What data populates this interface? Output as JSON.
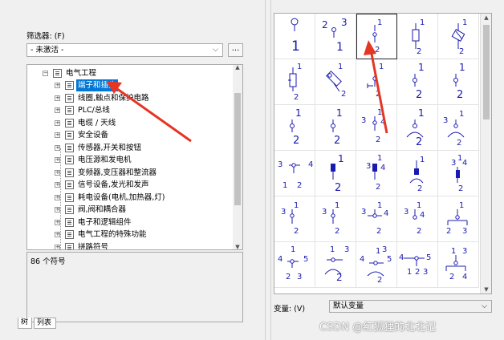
{
  "filter": {
    "label": "筛选器: (F)",
    "selected": "- 未激活 -",
    "more_button": "..."
  },
  "tree": {
    "root": "电气工程",
    "items": [
      {
        "label": "端子和插头"
      },
      {
        "label": "线圈,触点和保护电路"
      },
      {
        "label": "PLC/总线"
      },
      {
        "label": "电缆 / 天线"
      },
      {
        "label": "安全设备"
      },
      {
        "label": "传感器,开关和按钮"
      },
      {
        "label": "电压源和发电机"
      },
      {
        "label": "变频器,变压器和整流器"
      },
      {
        "label": "信号设备,发光和发声"
      },
      {
        "label": "耗电设备(电机,加热器,灯)"
      },
      {
        "label": "阀,阀和耦合器"
      },
      {
        "label": "电子和逻辑组件"
      },
      {
        "label": "电气工程的特殊功能"
      },
      {
        "label": "拼路符号"
      }
    ],
    "selected_index": 0,
    "expand_collapsed": "+",
    "expand_open": "−"
  },
  "symbol_count": "86 个符号",
  "tabs": [
    {
      "label": "树"
    },
    {
      "label": "列表"
    }
  ],
  "variant": {
    "label": "变量: (V)",
    "selected": "默认变量"
  },
  "symbols": [
    {
      "labels": [
        "1"
      ],
      "kind": "terminal-large",
      "selected": false
    },
    {
      "labels": [
        "2",
        "3",
        "1"
      ],
      "kind": "terminal-3",
      "selected": false
    },
    {
      "labels": [
        "1",
        "2"
      ],
      "kind": "terminal-small",
      "selected": true
    },
    {
      "labels": [
        "1",
        "2"
      ],
      "kind": "fuse-terminal",
      "selected": false
    },
    {
      "labels": [
        "1",
        "2"
      ],
      "kind": "fuse-terminal-diag",
      "selected": false
    },
    {
      "labels": [
        "1",
        "2"
      ],
      "kind": "fuse-side",
      "selected": false
    },
    {
      "labels": [
        "1",
        "2"
      ],
      "kind": "fuse-rotated",
      "selected": false
    },
    {
      "labels": [
        "1",
        "2"
      ],
      "kind": "terminal-tap",
      "selected": false
    },
    {
      "labels": [
        "1",
        "2"
      ],
      "kind": "terminal-plain",
      "selected": false
    },
    {
      "labels": [
        "1",
        "2"
      ],
      "kind": "terminal-plain",
      "selected": false
    },
    {
      "labels": [
        "1",
        "2"
      ],
      "kind": "terminal-plain",
      "selected": false
    },
    {
      "labels": [
        "1",
        "2"
      ],
      "kind": "terminal-plain",
      "selected": false
    },
    {
      "labels": [
        "3",
        "1",
        "4",
        "2"
      ],
      "kind": "terminal-4",
      "selected": false
    },
    {
      "labels": [
        "1",
        "2"
      ],
      "kind": "terminal-fork",
      "selected": false
    },
    {
      "labels": [
        "3",
        "1",
        "2"
      ],
      "kind": "terminal-fork3",
      "selected": false
    },
    {
      "labels": [
        "3",
        "4",
        "1",
        "2"
      ],
      "kind": "terminal-box4",
      "selected": false
    },
    {
      "labels": [
        "1",
        "2"
      ],
      "kind": "terminal-filled",
      "selected": false
    },
    {
      "labels": [
        "3",
        "1",
        "4",
        "2"
      ],
      "kind": "terminal-filled4",
      "selected": false
    },
    {
      "labels": [
        "1",
        "2"
      ],
      "kind": "terminal-filled-fork",
      "selected": false
    },
    {
      "labels": [
        "3",
        "1",
        "4",
        "2"
      ],
      "kind": "terminal-filled-fork4",
      "selected": false
    },
    {
      "labels": [
        "3",
        "1",
        "2"
      ],
      "kind": "terminal-3b",
      "selected": false
    },
    {
      "labels": [
        "3",
        "1",
        "2"
      ],
      "kind": "terminal-3b",
      "selected": false
    },
    {
      "labels": [
        "3",
        "1",
        "4",
        "2"
      ],
      "kind": "terminal-cross4",
      "selected": false
    },
    {
      "labels": [
        "3",
        "1",
        "4",
        "2"
      ],
      "kind": "terminal-3b4",
      "selected": false
    },
    {
      "labels": [
        "1",
        "2",
        "3"
      ],
      "kind": "terminal-t",
      "selected": false
    },
    {
      "labels": [
        "4",
        "1",
        "5",
        "2",
        "3"
      ],
      "kind": "terminal-5",
      "selected": false
    },
    {
      "labels": [
        "1",
        "3",
        "2"
      ],
      "kind": "terminal-5b",
      "selected": false
    },
    {
      "labels": [
        "4",
        "1",
        "3",
        "5",
        "2"
      ],
      "kind": "terminal-5c",
      "selected": false
    },
    {
      "labels": [
        "4",
        "5",
        "1",
        "2",
        "3"
      ],
      "kind": "terminal-5d",
      "selected": false
    },
    {
      "labels": [
        "1",
        "3",
        "2",
        "4"
      ],
      "kind": "terminal-t4",
      "selected": false
    }
  ],
  "watermark": "CSDN @红狐狸的北北记",
  "colors": {
    "selection": "#0078d7",
    "symbol": "#1a1ab0",
    "arrow": "#e53524"
  }
}
